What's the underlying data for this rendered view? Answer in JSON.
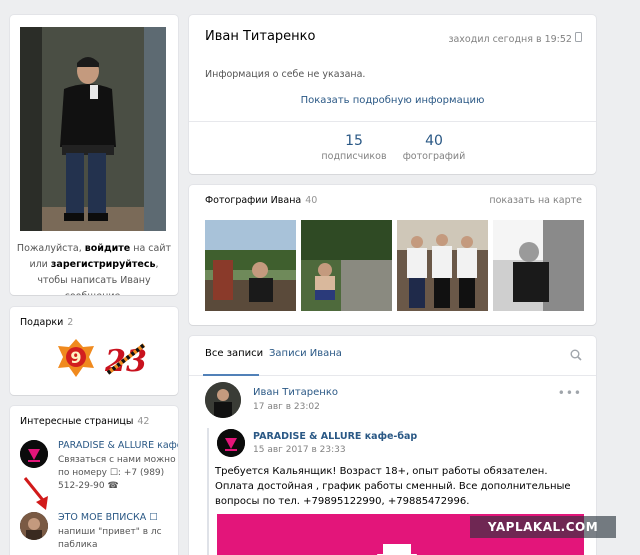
{
  "avatar_card": {
    "login_note_pre": "Пожалуйста, ",
    "login_link": "войдите",
    "login_note_mid": " на сайт или ",
    "register_link": "зарегистрируйтесь",
    "login_note_post": ", чтобы написать Ивану сообщение."
  },
  "gifts": {
    "title": "Подарки",
    "count": "2",
    "icons": [
      "gift-9-icon",
      "gift-23-icon"
    ]
  },
  "interesting_pages": {
    "title": "Интересные страницы",
    "count": "42",
    "items": [
      {
        "name": "PARADISE & ALLURE кафе-бар",
        "desc": "Связаться с нами можно по номеру ☐: +7 (989) 512-29-90 ☎"
      },
      {
        "name": "ЭТО МОЕ ВПИСКА ☐",
        "desc": "напиши \"привет\" в лс паблика"
      }
    ]
  },
  "profile": {
    "name": "Иван Титаренко",
    "online": "заходил сегодня в 19:52",
    "info": "Информация о себе не указана.",
    "more_link": "Показать подробную информацию",
    "counters": [
      {
        "value": "15",
        "label": "подписчиков"
      },
      {
        "value": "40",
        "label": "фотографий"
      }
    ]
  },
  "photos": {
    "title": "Фотографии Ивана",
    "count": "40",
    "map_link": "показать на карте"
  },
  "wall": {
    "tabs": [
      "Все записи",
      "Записи Ивана"
    ],
    "post": {
      "author": "Иван Титаренко",
      "date": "17 авг в 23:02",
      "repost_author": "PARADISE & ALLURE кафе-бар",
      "repost_date": "15 авг 2017 в 23:33",
      "text": "Требуется Кальянщик! Возраст 18+, опыт работы обязателен. Оплата достойная , график работы сменный. Все дополнительные вопросы по тел. +79895122990, +79885472996."
    }
  },
  "watermark": "YAPLAKAL.COM",
  "colors": {
    "link": "#2a5885",
    "accent": "#5181b8",
    "bg": "#edeef0",
    "banner": "#e3157a"
  }
}
